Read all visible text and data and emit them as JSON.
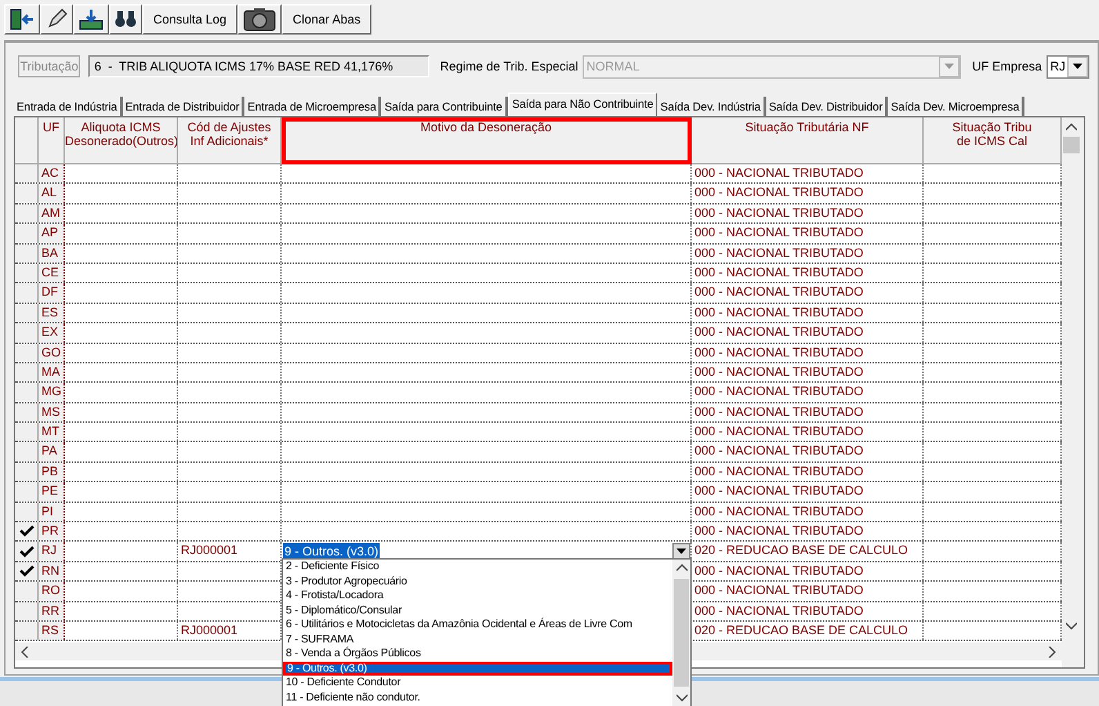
{
  "toolbar": {
    "log_button": "Consulta Log",
    "clone_button": "Clonar Abas"
  },
  "form": {
    "tributacao_button": "Tributação",
    "tributacao_value": "6  -  TRIB ALIQUOTA ICMS 17% BASE RED 41,176%",
    "regime_label": "Regime de Trib. Especial",
    "regime_value": "NORMAL",
    "uf_label": "UF Empresa",
    "uf_value": "RJ"
  },
  "tabs": [
    {
      "label": "Entrada de Indústria",
      "selected": false
    },
    {
      "label": "Entrada de Distribuidor",
      "selected": false
    },
    {
      "label": "Entrada de Microempresa",
      "selected": false
    },
    {
      "label": "Saída para Contribuinte",
      "selected": false
    },
    {
      "label": "Saída para Não Contribuinte",
      "selected": true
    },
    {
      "label": "Saída Dev. Indústria",
      "selected": false
    },
    {
      "label": "Saída Dev. Distribuidor",
      "selected": false
    },
    {
      "label": "Saída Dev. Microempresa",
      "selected": false
    }
  ],
  "table": {
    "columns": [
      {
        "label": "UF",
        "highlighted": false
      },
      {
        "label": "Aliquota ICMS\nDesonerado(Outros)",
        "highlighted": false
      },
      {
        "label": "Cód de Ajustes\nInf Adicionais*",
        "highlighted": false
      },
      {
        "label": "Motivo da Desoneração",
        "highlighted": true
      },
      {
        "label": "Situação Tributária NF",
        "highlighted": false
      },
      {
        "label": "Situação Tribu\nde ICMS Cal",
        "highlighted": false
      }
    ],
    "rows": [
      {
        "uf": "AC",
        "checked": false,
        "editing": false,
        "situacao": "000 - NACIONAL TRIBUTADO"
      },
      {
        "uf": "AL",
        "checked": false,
        "editing": false,
        "situacao": "000 - NACIONAL TRIBUTADO"
      },
      {
        "uf": "AM",
        "checked": false,
        "editing": false,
        "situacao": "000 - NACIONAL TRIBUTADO"
      },
      {
        "uf": "AP",
        "checked": false,
        "editing": false,
        "situacao": "000 - NACIONAL TRIBUTADO"
      },
      {
        "uf": "BA",
        "checked": false,
        "editing": false,
        "situacao": "000 - NACIONAL TRIBUTADO"
      },
      {
        "uf": "CE",
        "checked": false,
        "editing": false,
        "situacao": "000 - NACIONAL TRIBUTADO"
      },
      {
        "uf": "DF",
        "checked": false,
        "editing": false,
        "situacao": "000 - NACIONAL TRIBUTADO"
      },
      {
        "uf": "ES",
        "checked": false,
        "editing": false,
        "situacao": "000 - NACIONAL TRIBUTADO"
      },
      {
        "uf": "EX",
        "checked": false,
        "editing": false,
        "situacao": "000 - NACIONAL TRIBUTADO"
      },
      {
        "uf": "GO",
        "checked": false,
        "editing": false,
        "situacao": "000 - NACIONAL TRIBUTADO"
      },
      {
        "uf": "MA",
        "checked": false,
        "editing": false,
        "situacao": "000 - NACIONAL TRIBUTADO"
      },
      {
        "uf": "MG",
        "checked": false,
        "editing": false,
        "situacao": "000 - NACIONAL TRIBUTADO"
      },
      {
        "uf": "MS",
        "checked": false,
        "editing": false,
        "situacao": "000 - NACIONAL TRIBUTADO"
      },
      {
        "uf": "MT",
        "checked": false,
        "editing": false,
        "situacao": "000 - NACIONAL TRIBUTADO"
      },
      {
        "uf": "PA",
        "checked": false,
        "editing": false,
        "situacao": "000 - NACIONAL TRIBUTADO"
      },
      {
        "uf": "PB",
        "checked": false,
        "editing": false,
        "situacao": "000 - NACIONAL TRIBUTADO"
      },
      {
        "uf": "PE",
        "checked": false,
        "editing": false,
        "situacao": "000 - NACIONAL TRIBUTADO"
      },
      {
        "uf": "PI",
        "checked": false,
        "editing": false,
        "situacao": "000 - NACIONAL TRIBUTADO"
      },
      {
        "uf": "PR",
        "checked": true,
        "editing": false,
        "situacao": "000 - NACIONAL TRIBUTADO"
      },
      {
        "uf": "RJ",
        "checked": true,
        "editing": true,
        "cod": "RJ000001",
        "motivo": "9 - Outros. (v3.0)",
        "situacao": "020 - REDUCAO BASE DE CALCULO"
      },
      {
        "uf": "RN",
        "checked": true,
        "editing": false,
        "situacao": "000 - NACIONAL TRIBUTADO"
      },
      {
        "uf": "RO",
        "checked": false,
        "editing": false,
        "situacao": "000 - NACIONAL TRIBUTADO"
      },
      {
        "uf": "RR",
        "checked": false,
        "editing": false,
        "situacao": "000 - NACIONAL TRIBUTADO"
      },
      {
        "uf": "RS",
        "checked": false,
        "editing": false,
        "cod": "RJ000001",
        "situacao": "020 - REDUCAO BASE DE CALCULO"
      }
    ]
  },
  "dropdown": {
    "options": [
      {
        "label": "2 - Deficiente Físico",
        "selected": false
      },
      {
        "label": "3 - Produtor Agropecuário",
        "selected": false
      },
      {
        "label": "4 - Frotista/Locadora",
        "selected": false
      },
      {
        "label": "5 - Diplomático/Consular",
        "selected": false
      },
      {
        "label": "6 - Utilitários e Motocicletas da Amazônia Ocidental e Áreas de Livre Com",
        "selected": false
      },
      {
        "label": "7 - SUFRAMA",
        "selected": false
      },
      {
        "label": "8 - Venda a Órgãos Públicos",
        "selected": false
      },
      {
        "label": "9 - Outros. (v3.0)",
        "selected": true
      },
      {
        "label": "10 - Deficiente Condutor",
        "selected": false
      },
      {
        "label": "11 - Deficiente não condutor.",
        "selected": false
      }
    ]
  }
}
